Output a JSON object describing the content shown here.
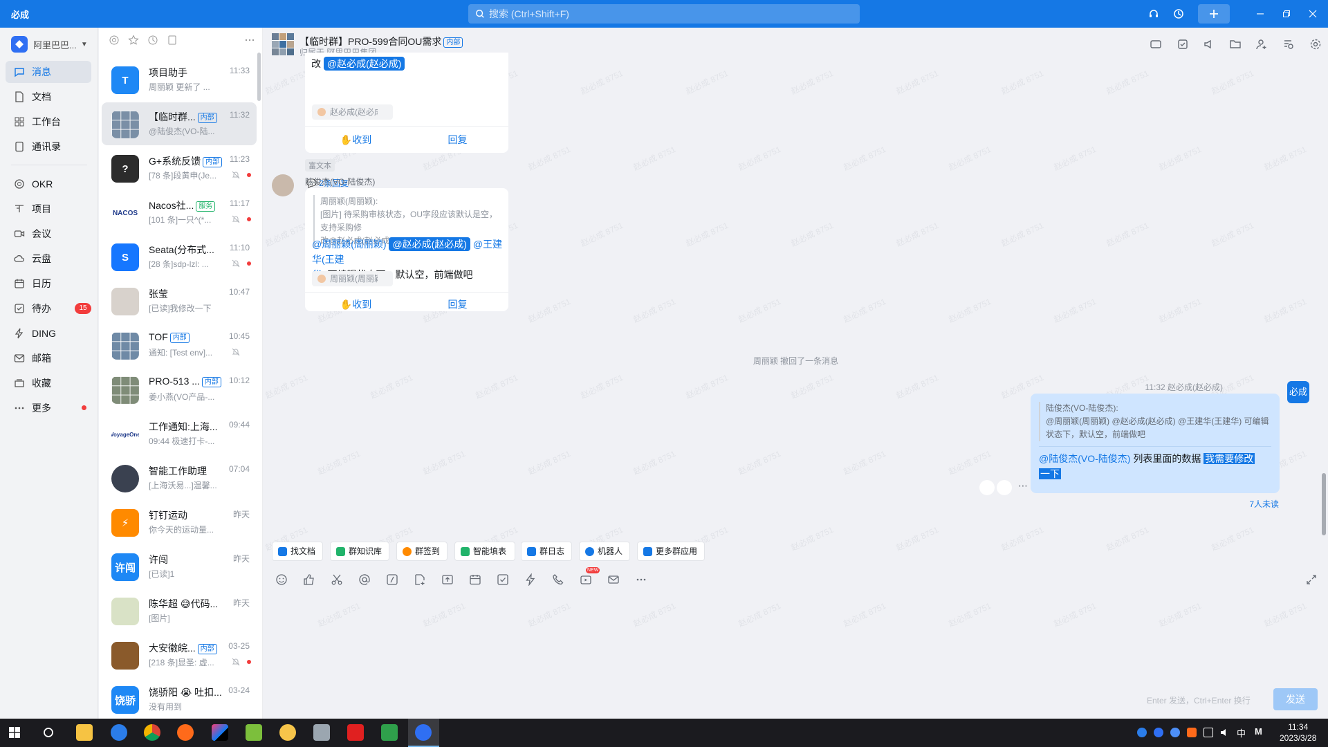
{
  "app": {
    "name": "必成",
    "search_placeholder": "搜索 (Ctrl+Shift+F)"
  },
  "nav": {
    "org": "阿里巴巴...",
    "items": [
      {
        "label": "消息",
        "icon": "chat-icon"
      },
      {
        "label": "文档",
        "icon": "doc-icon"
      },
      {
        "label": "工作台",
        "icon": "grid-icon"
      },
      {
        "label": "通讯录",
        "icon": "contacts-icon"
      },
      {
        "label": "OKR",
        "icon": "target-icon"
      },
      {
        "label": "项目",
        "icon": "project-icon"
      },
      {
        "label": "会议",
        "icon": "meeting-icon"
      },
      {
        "label": "云盘",
        "icon": "cloud-icon"
      },
      {
        "label": "日历",
        "icon": "calendar-icon"
      },
      {
        "label": "待办",
        "icon": "todo-icon",
        "badge": "15"
      },
      {
        "label": "DING",
        "icon": "lightning-icon"
      },
      {
        "label": "邮箱",
        "icon": "mail-icon"
      },
      {
        "label": "收藏",
        "icon": "favorite-icon"
      },
      {
        "label": "更多",
        "icon": "more-icon"
      }
    ]
  },
  "conversations": [
    {
      "name": "项目助手",
      "time": "11:33",
      "preview": "周丽颖 更新了 ...",
      "avatar_text": "T",
      "avatar_color": "#1e88f5",
      "tag": ""
    },
    {
      "name": "【临时群...",
      "time": "11:32",
      "preview": "@陆俊杰(VO-陆...",
      "avatar_text": "",
      "avatar_color": "#7a8fa6",
      "tag": "内部"
    },
    {
      "name": "G+系统反馈",
      "time": "11:23",
      "preview": "[78 条]段黄申(Je...",
      "avatar_text": "?",
      "avatar_color": "#2c2c2c",
      "tag": "内部"
    },
    {
      "name": "Nacos社...",
      "time": "11:17",
      "preview": "[101 条]一只^(*...",
      "avatar_text": "NACOS",
      "avatar_color": "#ffffff",
      "tag": "服务"
    },
    {
      "name": "Seata(分布式...",
      "time": "11:10",
      "preview": "[28 条]sdp-lzl: ...",
      "avatar_text": "S",
      "avatar_color": "#1677ff",
      "tag": ""
    },
    {
      "name": "张莹",
      "time": "10:47",
      "preview": "[已读]我修改一下",
      "avatar_text": "",
      "avatar_color": "#d8d2cc",
      "tag": ""
    },
    {
      "name": "TOF",
      "time": "10:45",
      "preview": "通知: [Test env]...",
      "avatar_text": "",
      "avatar_color": "#6f8aa6",
      "tag": "内部"
    },
    {
      "name": "PRO-513 ...",
      "time": "10:12",
      "preview": "姜小燕(VO产品-...",
      "avatar_text": "",
      "avatar_color": "#7f8c78",
      "tag": "内部"
    },
    {
      "name": "工作通知:上海...",
      "time": "09:44",
      "preview": "09:44 极速打卡-...",
      "avatar_text": "VoyageOne",
      "avatar_color": "#ffffff",
      "tag": ""
    },
    {
      "name": "智能工作助理",
      "time": "07:04",
      "preview": "[上海沃易...]温馨...",
      "avatar_text": "",
      "avatar_color": "#3a4150",
      "tag": ""
    },
    {
      "name": "钉钉运动",
      "time": "昨天",
      "preview": "你今天的运动量...",
      "avatar_text": "⚡",
      "avatar_color": "#ff8a00",
      "tag": ""
    },
    {
      "name": "许闯",
      "time": "昨天",
      "preview": "[已读]1",
      "avatar_text": "许闯",
      "avatar_color": "#1e88f5",
      "tag": ""
    },
    {
      "name": "陈华超 😅代码...",
      "time": "昨天",
      "preview": "[图片]",
      "avatar_text": "",
      "avatar_color": "#d9e2c6",
      "tag": ""
    },
    {
      "name": "大安徽皖...",
      "time": "03-25",
      "preview": "[218 条]显圣: 虚...",
      "avatar_text": "",
      "avatar_color": "#8a5a2b",
      "tag": "内部"
    },
    {
      "name": "饶骄阳 😭 吐扣...",
      "time": "03-24",
      "preview": "没有用到",
      "avatar_text": "饶骄",
      "avatar_color": "#1e88f5",
      "tag": ""
    }
  ],
  "chat": {
    "title": "【临时群】PRO-599合同OU需求",
    "title_tag": "内部",
    "subtitle": "归属于 阿里巴巴集团",
    "msg1": {
      "lead": "改",
      "mention": "@赵必成(赵必成)",
      "reaction": "赵必成(赵必成)",
      "ack": "收到",
      "reply": "回复",
      "type_tag": "富文本",
      "replies": "2条回复"
    },
    "msg2": {
      "sender": "陆俊杰(VO-陆俊杰)",
      "quote_line1": "周丽颖(周丽颖):",
      "quote_line2": "[图片] 待采购审核状态，OU字段应该默认是空，支持采购修",
      "quote_line3": "改@赵必成(赵必成)",
      "mention_a": "@周丽颖(周丽颖)",
      "mention_b": "@赵必成(赵必成)",
      "mention_c1": "@王建华(王建",
      "mention_c2": "华)",
      "text": " 可编辑状态下，默认空，前端做吧",
      "reaction": "周丽颖(周丽颖)",
      "ack": "收到",
      "reply": "回复"
    },
    "system": "周丽颖 撤回了一条消息",
    "msg3": {
      "time_sender": "11:32 赵必成(赵必成)",
      "avatar": "必成",
      "quote_line1": "陆俊杰(VO-陆俊杰):",
      "quote_line2": "@周丽颖(周丽颖) @赵必成(赵必成) @王建华(王建华) 可编辑",
      "quote_line3": "状态下，默认空，前端做吧",
      "mention": "@陆俊杰(VO-陆俊杰)",
      "text": " 列表里面的数据 ",
      "highlight1": "我需要修改",
      "highlight2": "一下",
      "unread": "7人未读"
    },
    "apps": [
      "找文档",
      "群知识库",
      "群签到",
      "智能填表",
      "群日志",
      "机器人",
      "更多群应用"
    ],
    "input_hint": "Enter 发送，Ctrl+Enter 换行",
    "send_label": "发送",
    "new_label": "NEW"
  },
  "watermark": "赵必成 8751",
  "taskbar": {
    "time": "11:34",
    "date": "2023/3/28",
    "ime": "中"
  }
}
